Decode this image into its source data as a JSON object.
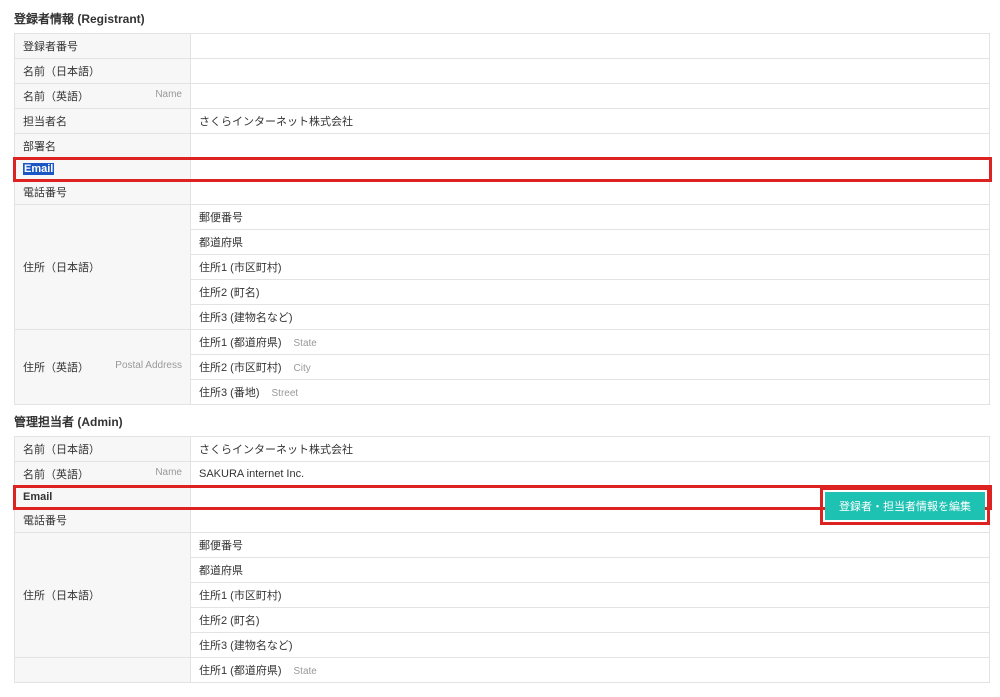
{
  "registrant": {
    "title": "登録者情報 (Registrant)",
    "rows": {
      "reg_no_label": "登録者番号",
      "name_jp_label": "名前（日本語）",
      "name_en_label": "名前（英語）",
      "name_en_label_en": "Name",
      "tantou_label": "担当者名",
      "tantou_value": "さくらインターネット株式会社",
      "busho_label": "部署名",
      "email_label": "Email",
      "tel_label": "電話番号",
      "addr_jp_label": "住所（日本語）",
      "addr_sub_zip": "郵便番号",
      "addr_sub_pref": "都道府県",
      "addr_sub_j1": "住所1 (市区町村)",
      "addr_sub_j2": "住所2 (町名)",
      "addr_sub_j3": "住所3 (建物名など)",
      "addr_en_label": "住所（英語）",
      "addr_en_label_en": "Postal Address",
      "addr_sub_e1": "住所1 (都道府県)",
      "addr_sub_e1_en": "State",
      "addr_sub_e2": "住所2 (市区町村)",
      "addr_sub_e2_en": "City",
      "addr_sub_e3": "住所3 (番地)",
      "addr_sub_e3_en": "Street"
    }
  },
  "admin": {
    "title": "管理担当者 (Admin)",
    "rows": {
      "name_jp_label": "名前（日本語）",
      "name_jp_value": "さくらインターネット株式会社",
      "name_en_label": "名前（英語）",
      "name_en_label_en": "Name",
      "name_en_value": "SAKURA internet Inc.",
      "email_label": "Email",
      "tel_label": "電話番号",
      "addr_jp_label": "住所（日本語）",
      "addr_sub_zip": "郵便番号",
      "addr_sub_pref": "都道府県",
      "addr_sub_j1": "住所1 (市区町村)",
      "addr_sub_j2": "住所2 (町名)",
      "addr_sub_j3": "住所3 (建物名など)",
      "addr_sub_e1": "住所1 (都道府県)",
      "addr_sub_e1_en": "State"
    }
  },
  "edit_button_label": "登録者・担当者情報を編集"
}
